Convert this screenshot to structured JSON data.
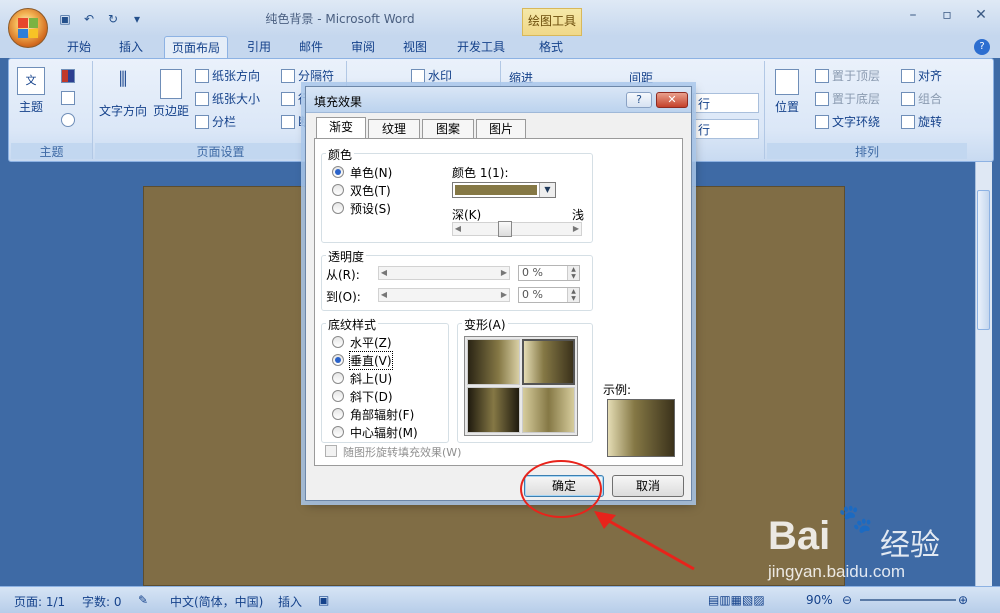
{
  "window": {
    "title": "纯色背景 - Microsoft Word",
    "context_tab": "绘图工具"
  },
  "ribbon_tabs": [
    "开始",
    "插入",
    "页面布局",
    "引用",
    "邮件",
    "审阅",
    "视图",
    "开发工具",
    "格式"
  ],
  "ribbon": {
    "theme_group": {
      "label": "主题",
      "btn": "主题"
    },
    "page_setup": {
      "label": "页面设置",
      "text_dir": "文字方向",
      "margins": "页边距",
      "orientation": "纸张方向",
      "size": "纸张大小",
      "columns": "分栏",
      "breaks": "分隔符",
      "line_numbers": "行",
      "hyphenation": "断"
    },
    "background": {
      "watermark": "水印"
    },
    "paragraph": {
      "indent": "缩进",
      "spacing": "间距",
      "row1": "行",
      "row2": "行"
    },
    "arrange": {
      "label": "排列",
      "position": "位置",
      "bring_front": "置于顶层",
      "send_back": "置于底层",
      "wrap": "文字环绕",
      "align": "对齐",
      "group": "组合",
      "rotate": "旋转"
    }
  },
  "dialog": {
    "title": "填充效果",
    "help": "?",
    "tabs": [
      "渐变",
      "纹理",
      "图案",
      "图片"
    ],
    "active_tab": "渐变",
    "colors": {
      "legend": "颜色",
      "options": [
        "单色(N)",
        "双色(T)",
        "预设(S)"
      ],
      "selected": "单色(N)",
      "color1_label": "颜色 1(1):",
      "color1_value": "#857845",
      "dark_label": "深(K)",
      "light_label": "浅",
      "shade_position": 0.35
    },
    "transparency": {
      "legend": "透明度",
      "from_label": "从(R):",
      "to_label": "到(O):",
      "from_value": "0 %",
      "to_value": "0 %"
    },
    "shading": {
      "legend": "底纹样式",
      "options": [
        "水平(Z)",
        "垂直(V)",
        "斜上(U)",
        "斜下(D)",
        "角部辐射(F)",
        "中心辐射(M)"
      ],
      "selected": "垂直(V)"
    },
    "variants": {
      "legend": "变形(A)"
    },
    "sample": {
      "label": "示例:"
    },
    "rotate_checkbox": "随图形旋转填充效果(W)",
    "ok": "确定",
    "cancel": "取消"
  },
  "statusbar": {
    "page": "页面: 1/1",
    "words": "字数: 0",
    "language": "中文(简体，中国)",
    "mode": "插入",
    "zoom": "90%"
  },
  "watermark": {
    "brand": "Bai",
    "brand2": "经验",
    "url": "jingyan.baidu.com"
  },
  "colors": {
    "page_fill": "#806d45",
    "accent_red": "#e8231b"
  }
}
